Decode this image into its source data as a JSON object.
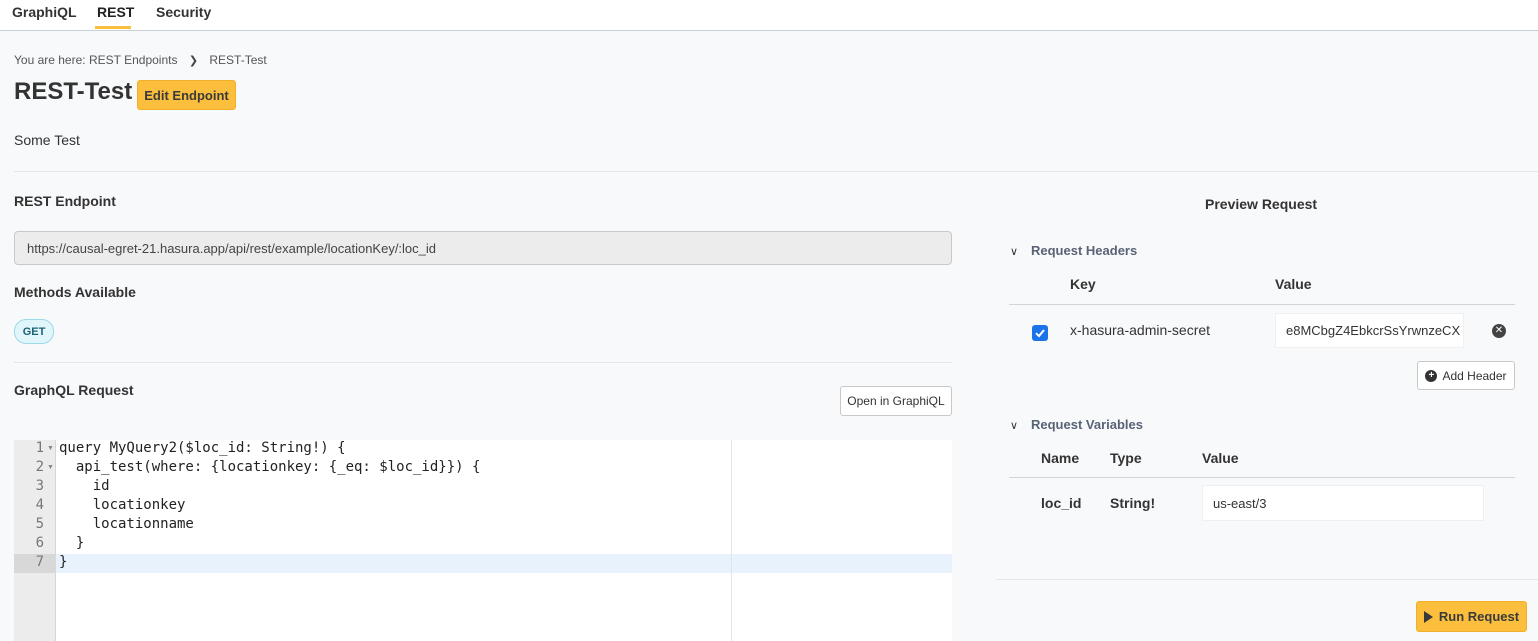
{
  "tabs": [
    {
      "label": "GraphiQL"
    },
    {
      "label": "REST"
    },
    {
      "label": "Security"
    }
  ],
  "breadcrumb": {
    "prefix": "You are here:",
    "items": [
      "REST Endpoints",
      "REST-Test"
    ]
  },
  "page": {
    "title": "REST-Test",
    "edit_label": "Edit Endpoint",
    "description": "Some Test"
  },
  "endpoint": {
    "label": "REST Endpoint",
    "url": "https://causal-egret-21.hasura.app/api/rest/example/locationKey/:loc_id"
  },
  "methods": {
    "label": "Methods Available",
    "items": [
      "GET"
    ]
  },
  "graphql": {
    "label": "GraphQL Request",
    "open_label": "Open in GraphiQL",
    "lines": [
      "query MyQuery2($loc_id: String!) {",
      "  api_test(where: {locationkey: {_eq: $loc_id}}) {",
      "    id",
      "    locationkey",
      "    locationname",
      "  }",
      "}"
    ],
    "line_numbers": [
      "1",
      "2",
      "3",
      "4",
      "5",
      "6",
      "7"
    ]
  },
  "preview": {
    "title": "Preview Request",
    "headers": {
      "title": "Request Headers",
      "col_key": "Key",
      "col_value": "Value",
      "rows": [
        {
          "key": "x-hasura-admin-secret",
          "value": "e8MCbgZ4EbkcrSsYrwnzeCX",
          "checked": true
        }
      ],
      "add_label": "Add Header"
    },
    "variables": {
      "title": "Request Variables",
      "col_name": "Name",
      "col_type": "Type",
      "col_value": "Value",
      "rows": [
        {
          "name": "loc_id",
          "type": "String!",
          "value": "us-east/3"
        }
      ]
    },
    "run_label": "Run Request"
  },
  "icons": {
    "checkbox": "check-icon",
    "remove": "remove-circle-icon",
    "add": "plus-circle-icon",
    "run": "play-icon",
    "collapse": "chevron-down-icon",
    "breadcrumb_sep": "chevron-right-icon"
  },
  "colors": {
    "accent": "#fbbf3d",
    "checkbox": "#1a73e8",
    "badge_bg": "#e0f6fb",
    "active_line": "#e8f2fd"
  }
}
